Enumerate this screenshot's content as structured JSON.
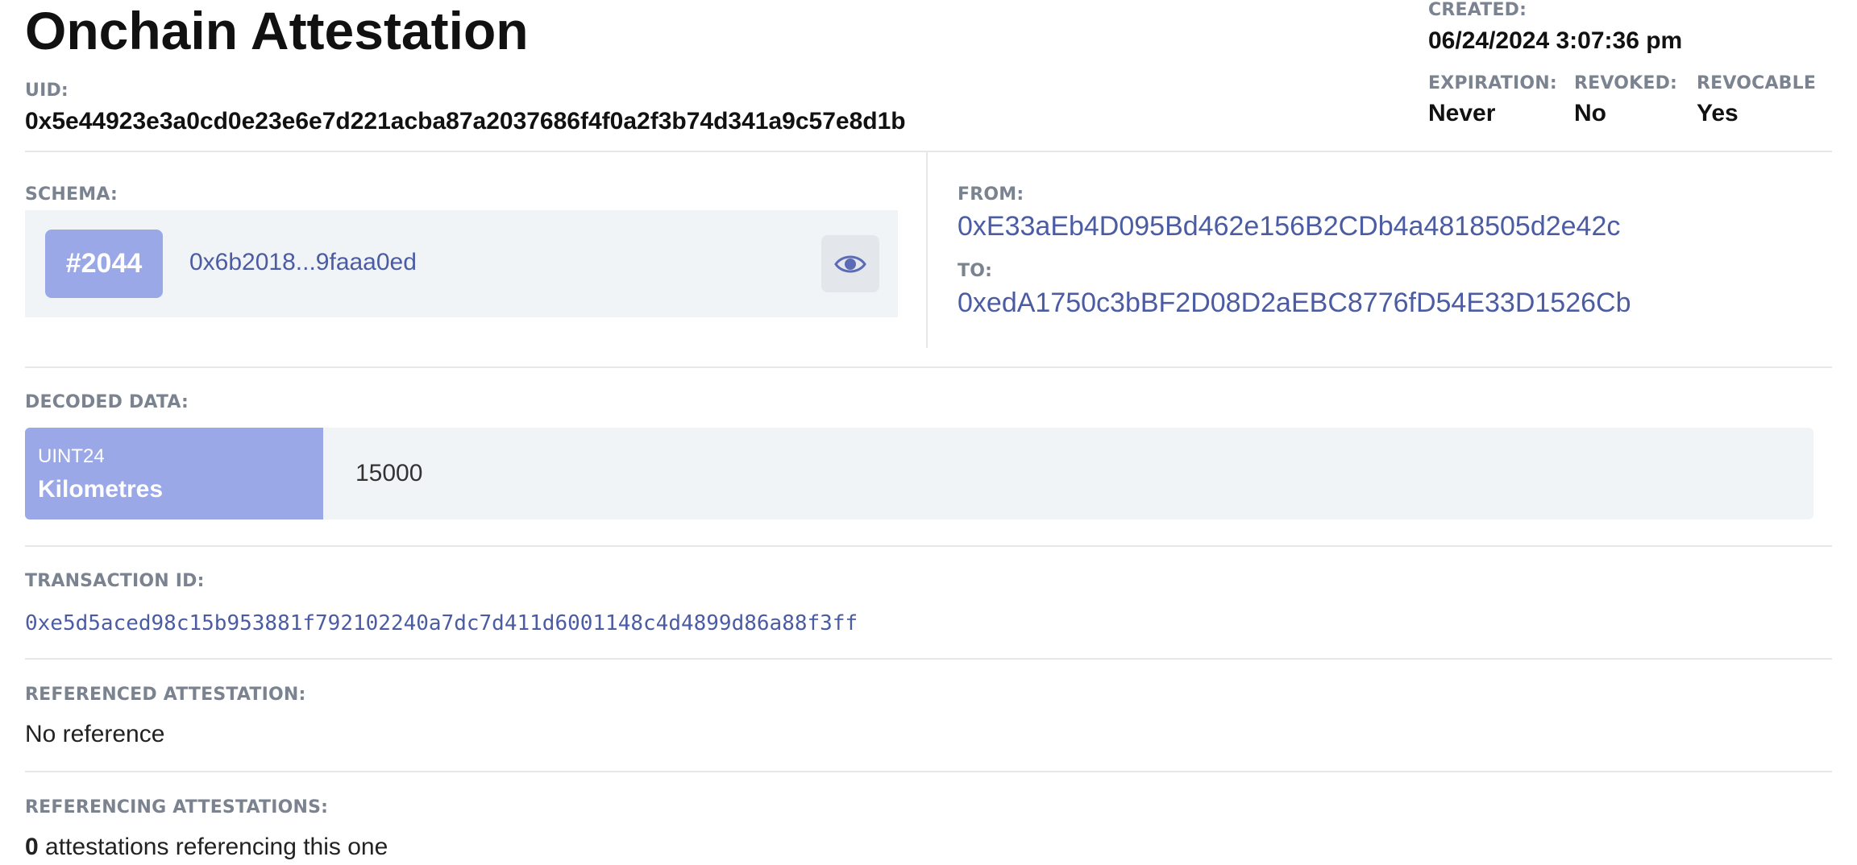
{
  "title": "Onchain Attestation",
  "uid": {
    "label": "UID:",
    "value": "0x5e44923e3a0cd0e23e6e7d221acba87a2037686f4f0a2f3b74d341a9c57e8d1b"
  },
  "created": {
    "label": "CREATED:",
    "value": "06/24/2024 3:07:36 pm"
  },
  "expiration": {
    "label": "EXPIRATION:",
    "value": "Never"
  },
  "revoked": {
    "label": "REVOKED:",
    "value": "No"
  },
  "revocable": {
    "label": "REVOCABLE",
    "value": "Yes"
  },
  "schema": {
    "label": "SCHEMA:",
    "id": "#2044",
    "hash": "0x6b2018...9faaa0ed",
    "view_icon": "eye-icon"
  },
  "from": {
    "label": "FROM:",
    "value": "0xE33aEb4D095Bd462e156B2CDb4a4818505d2e42c"
  },
  "to": {
    "label": "TO:",
    "value": "0xedA1750c3bBF2D08D2aEBC8776fD54E33D1526Cb"
  },
  "decoded": {
    "label": "DECODED DATA:",
    "fields": [
      {
        "type": "UINT24",
        "name": "Kilometres",
        "value": "15000"
      }
    ]
  },
  "transaction": {
    "label": "TRANSACTION ID:",
    "value": "0xe5d5aced98c15b953881f792102240a7dc7d411d6001148c4d4899d86a88f3ff"
  },
  "referenced": {
    "label": "REFERENCED ATTESTATION:",
    "value": "No reference"
  },
  "referencing": {
    "label": "REFERENCING ATTESTATIONS:",
    "count": "0",
    "text": "attestations referencing this one"
  },
  "colors": {
    "accent": "#9aa8e7",
    "link": "#4b5ca3",
    "label": "#7a838f",
    "panel": "#f1f4f6"
  }
}
